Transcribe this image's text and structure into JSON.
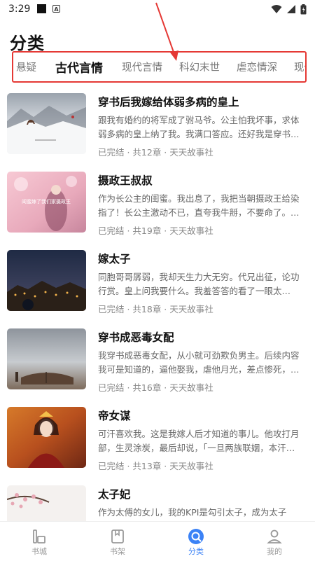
{
  "status": {
    "time": "3:29",
    "a_icon": "A"
  },
  "page_title": "分类",
  "tabs": [
    "悬疑",
    "古代言情",
    "现代言情",
    "科幻末世",
    "虐恋情深",
    "现代都"
  ],
  "active_tab_index": 1,
  "books": [
    {
      "title": "穿书后我嫁给体弱多病的皇上",
      "desc": "跟我有婚约的将军成了驸马爷。公主怕我坏事，求体弱多病的皇上纳了我。我满口答应。还好我是穿书的…",
      "meta": "已完结 · 共12章 · 天天故事社",
      "cover_text": ""
    },
    {
      "title": "摄政王叔叔",
      "desc": "作为长公主的闺蜜。我出息了，我把当朝摄政王给染指了！长公主激动不已，直夸我牛掰，不要命了。呜…",
      "meta": "已完结 · 共19章 · 天天故事社",
      "cover_text": "闺蜜嫁了我们家摄政王"
    },
    {
      "title": "嫁太子",
      "desc": "同胞哥哥孱弱，我却天生力大无穷。代兄出征，论功行赏。皇上问我要什么。我羞答答的看了一眼太子，…",
      "meta": "已完结 · 共18章 · 天天故事社",
      "cover_text": ""
    },
    {
      "title": "穿书成恶毒女配",
      "desc": "我穿书成恶毒女配，从小就可劲欺负男主。后续内容我可是知道的，逼他娶我，虐他月光，差点惨死，最…",
      "meta": "已完结 · 共16章 · 天天故事社",
      "cover_text": ""
    },
    {
      "title": "帝女谋",
      "desc": "可汗喜欢我。这是我嫁人后才知道的事儿。他攻打月部，生灵涂炭，最后却说，「一旦两族联姻，本汗…",
      "meta": "已完结 · 共13章 · 天天故事社",
      "cover_text": ""
    },
    {
      "title": "太子妃",
      "desc": "作为太傅的女儿，我的KPI是勾引太子，成为太子妃。…",
      "meta": "",
      "cover_text": ""
    }
  ],
  "nav": [
    {
      "label": "书城",
      "icon": "book-store-icon"
    },
    {
      "label": "书架",
      "icon": "bookshelf-icon"
    },
    {
      "label": "分类",
      "icon": "category-icon"
    },
    {
      "label": "我的",
      "icon": "profile-icon"
    }
  ],
  "active_nav_index": 2,
  "colors": {
    "accent": "#3b82f6",
    "highlight_box": "#e53935",
    "annotation_arrow": "#e53935"
  }
}
